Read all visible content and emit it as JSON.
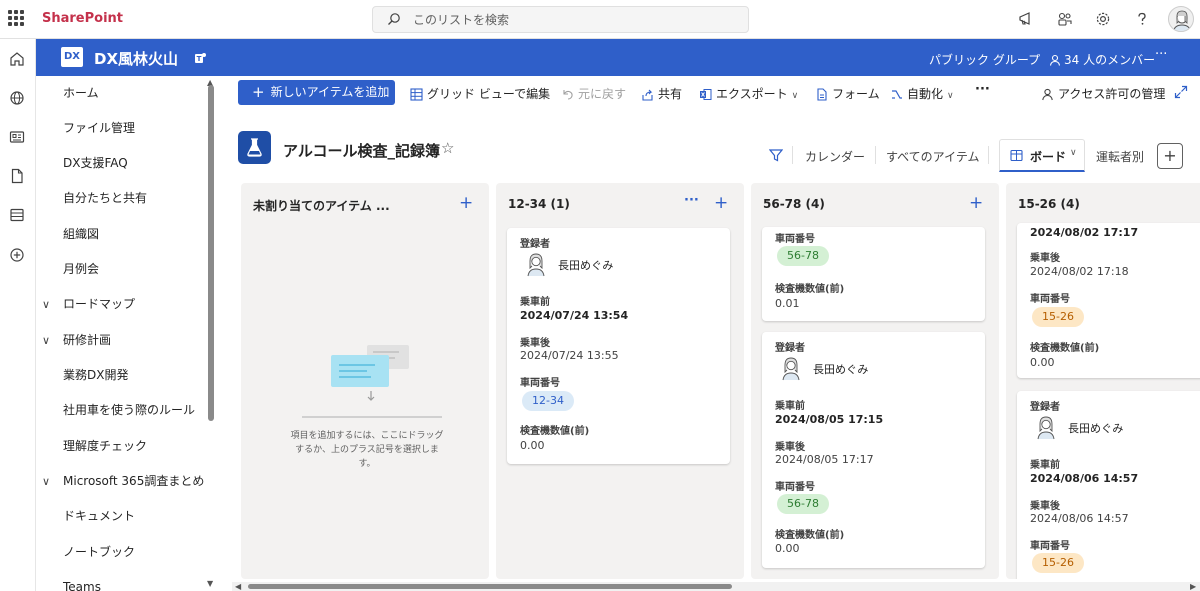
{
  "suite": {
    "app_name": "SharePoint",
    "search_placeholder": "このリストを検索",
    "icons": [
      "megaphone-icon",
      "teams-share-icon",
      "settings-icon",
      "help-icon",
      "user-avatar"
    ]
  },
  "rail": {
    "icons": [
      "home-icon",
      "globe-icon",
      "news-icon",
      "document-icon",
      "list-icon",
      "add-circle-icon"
    ]
  },
  "site": {
    "logo_text": "DX",
    "title": "DX風林火山",
    "group_label": "パブリック グループ",
    "members_label": "34 人のメンバー",
    "more": "···",
    "colors": {
      "header_bg": "#2f5fc9"
    }
  },
  "nav": {
    "items": [
      {
        "label": "ホーム",
        "chevron": ""
      },
      {
        "label": "ファイル管理",
        "chevron": ""
      },
      {
        "label": "DX支援FAQ",
        "chevron": ""
      },
      {
        "label": "自分たちと共有",
        "chevron": ""
      },
      {
        "label": "組織図",
        "chevron": ""
      },
      {
        "label": "月例会",
        "chevron": ""
      },
      {
        "label": "ロードマップ",
        "chevron": "∨"
      },
      {
        "label": "研修計画",
        "chevron": "∨"
      },
      {
        "label": "業務DX開発",
        "chevron": ""
      },
      {
        "label": "社用車を使う際のルール",
        "chevron": ""
      },
      {
        "label": "理解度チェック",
        "chevron": ""
      },
      {
        "label": "Microsoft 365調査まとめ",
        "chevron": "∨"
      },
      {
        "label": "ドキュメント",
        "chevron": ""
      },
      {
        "label": "ノートブック",
        "chevron": ""
      },
      {
        "label": "Teams",
        "chevron": ""
      }
    ]
  },
  "commands": {
    "new_item": "新しいアイテムを追加",
    "grid_edit": "グリッド ビューで編集",
    "undo": "元に戻す",
    "share": "共有",
    "export": "エクスポート",
    "form": "フォーム",
    "automate": "自動化",
    "more": "···",
    "access": "アクセス許可の管理"
  },
  "list": {
    "title": "アルコール検査_記録簿",
    "views": {
      "calendar": "カレンダー",
      "all_items": "すべてのアイテム",
      "board": "ボード",
      "by_driver": "運転者別"
    },
    "add_view": "+"
  },
  "board": {
    "columns": [
      {
        "title": "未割り当てのアイテム ...",
        "empty_text": "項目を追加するには、ここにドラッグするか、上のプラス記号を選択します。",
        "cards": []
      },
      {
        "title": "12-34 (1)",
        "cards": [
          {
            "registrant_label": "登録者",
            "registrant": "長田めぐみ",
            "before_label": "乗車前",
            "before": "2024/07/24 13:54",
            "after_label": "乗車後",
            "after": "2024/07/24 13:55",
            "vehicle_label": "車両番号",
            "vehicle": "12-34",
            "reading_label": "検査機数値(前)",
            "reading": "0.00"
          }
        ]
      },
      {
        "title": "56-78 (4)",
        "cards": [
          {
            "vehicle_label": "車両番号",
            "vehicle": "56-78",
            "reading_label": "検査機数値(前)",
            "reading": "0.01"
          },
          {
            "registrant_label": "登録者",
            "registrant": "長田めぐみ",
            "before_label": "乗車前",
            "before": "2024/08/05 17:15",
            "after_label": "乗車後",
            "after": "2024/08/05 17:17",
            "vehicle_label": "車両番号",
            "vehicle": "56-78",
            "reading_label": "検査機数値(前)",
            "reading": "0.00"
          }
        ]
      },
      {
        "title": "15-26 (4)",
        "cards": [
          {
            "before": "2024/08/02 17:17",
            "after_label": "乗車後",
            "after": "2024/08/02 17:18",
            "vehicle_label": "車両番号",
            "vehicle": "15-26",
            "reading_label": "検査機数値(前)",
            "reading": "0.00"
          },
          {
            "registrant_label": "登録者",
            "registrant": "長田めぐみ",
            "before_label": "乗車前",
            "before": "2024/08/06 14:57",
            "after_label": "乗車後",
            "after": "2024/08/06 14:57",
            "vehicle_label": "車両番号",
            "vehicle": "15-26"
          }
        ]
      }
    ],
    "colors": {
      "chip_12_34": "#dbeaf7",
      "chip_56_78": "#d4f0d4",
      "chip_15_26": "#fde7c5"
    }
  }
}
